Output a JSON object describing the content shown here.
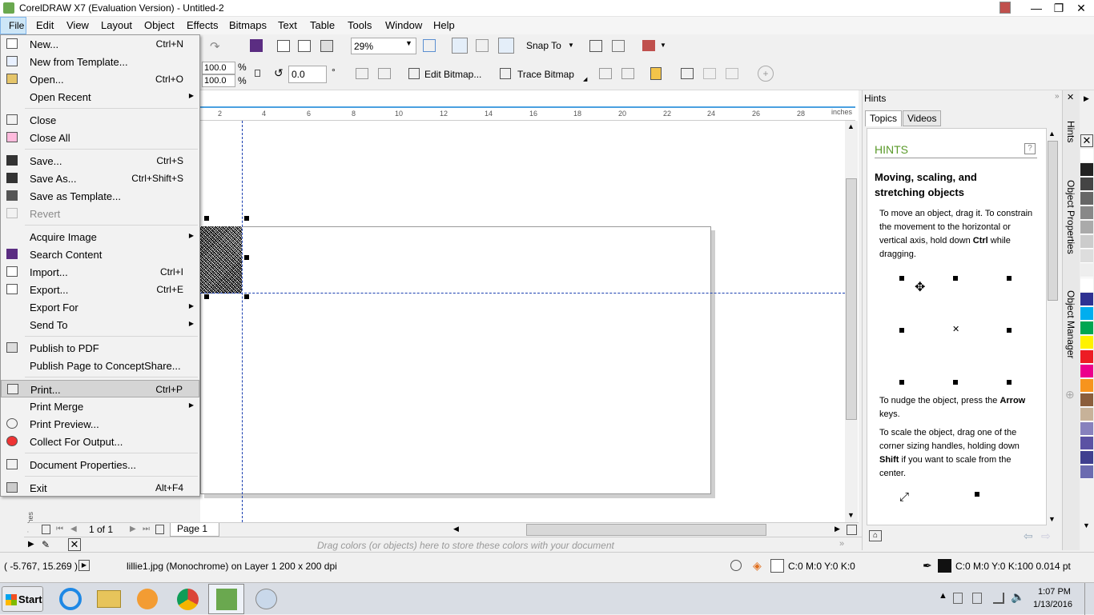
{
  "app": {
    "title": "CorelDRAW X7 (Evaluation Version) - Untitled-2"
  },
  "menubar": [
    "File",
    "Edit",
    "View",
    "Layout",
    "Object",
    "Effects",
    "Bitmaps",
    "Text",
    "Table",
    "Tools",
    "Window",
    "Help"
  ],
  "toolbar": {
    "zoom": "29%",
    "snap_to": "Snap To",
    "scale_x": "100.0",
    "scale_y": "100.0",
    "pct": "%",
    "angle": "0.0",
    "deg": "°",
    "edit_bitmap": "Edit Bitmap...",
    "trace_bitmap": "Trace Bitmap"
  },
  "ruler": {
    "unit": "inches",
    "ticks": [
      "2",
      "4",
      "6",
      "8",
      "10",
      "12",
      "14",
      "16",
      "18",
      "20",
      "22",
      "24",
      "26",
      "28"
    ]
  },
  "file_menu": [
    {
      "label": "New...",
      "shortcut": "Ctrl+N"
    },
    {
      "label": "New from Template...",
      "shortcut": ""
    },
    {
      "label": "Open...",
      "shortcut": "Ctrl+O"
    },
    {
      "label": "Open Recent",
      "shortcut": ""
    },
    {
      "label": "Close",
      "shortcut": ""
    },
    {
      "label": "Close All",
      "shortcut": ""
    },
    {
      "label": "Save...",
      "shortcut": "Ctrl+S"
    },
    {
      "label": "Save As...",
      "shortcut": "Ctrl+Shift+S"
    },
    {
      "label": "Save as Template...",
      "shortcut": ""
    },
    {
      "label": "Revert",
      "shortcut": ""
    },
    {
      "label": "Acquire Image",
      "shortcut": ""
    },
    {
      "label": "Search Content",
      "shortcut": ""
    },
    {
      "label": "Import...",
      "shortcut": "Ctrl+I"
    },
    {
      "label": "Export...",
      "shortcut": "Ctrl+E"
    },
    {
      "label": "Export For",
      "shortcut": ""
    },
    {
      "label": "Send To",
      "shortcut": ""
    },
    {
      "label": "Publish to PDF",
      "shortcut": ""
    },
    {
      "label": "Publish Page to ConceptShare...",
      "shortcut": ""
    },
    {
      "label": "Print...",
      "shortcut": "Ctrl+P"
    },
    {
      "label": "Print Merge",
      "shortcut": ""
    },
    {
      "label": "Print Preview...",
      "shortcut": ""
    },
    {
      "label": "Collect For Output...",
      "shortcut": ""
    },
    {
      "label": "Document Properties...",
      "shortcut": ""
    },
    {
      "label": "Exit",
      "shortcut": "Alt+F4"
    }
  ],
  "hints": {
    "panel_title": "Hints",
    "tab_topics": "Topics",
    "tab_videos": "Videos",
    "heading": "HINTS",
    "topic": "Moving, scaling, and stretching objects",
    "p1a": "To move an object, drag it. To constrain the movement to the horizontal or vertical axis, hold down ",
    "p1b": "Ctrl",
    "p1c": " while dragging.",
    "p2a": "To nudge the object, press the ",
    "p2b": "Arrow",
    "p2c": " keys.",
    "p3a": "To scale the object, drag one of the corner sizing handles, holding down ",
    "p3b": "Shift",
    "p3c": " if you want to scale from the center."
  },
  "docker_tabs": [
    "Hints",
    "Object Properties",
    "Object Manager"
  ],
  "pagebar": {
    "page_count": "1 of 1",
    "page_tab": "Page 1",
    "ruler_unit": "inches"
  },
  "colorbar": {
    "hint": "Drag colors (or objects) here to store these colors with your document"
  },
  "status": {
    "coords": "( -5.767, 15.269 )",
    "object_info": "lillie1.jpg (Monochrome) on Layer 1 200 x 200 dpi",
    "fill": "C:0 M:0 Y:0 K:0",
    "outline": "C:0 M:0 Y:0 K:100  0.014 pt"
  },
  "taskbar": {
    "start": "Start",
    "time": "1:07 PM",
    "date": "1/13/2016"
  },
  "palette": [
    "#ffffff",
    "#222222",
    "#444444",
    "#666666",
    "#888888",
    "#aaaaaa",
    "#cccccc",
    "#dddddd",
    "#eeeeee",
    "#ffffff",
    "#2e3192",
    "#00aeef",
    "#00a651",
    "#fff200",
    "#ed1c24",
    "#ec008c",
    "#f7941d",
    "#8b5e3c",
    "#c7b299",
    "#8781bd",
    "#5b52a3",
    "#3f3f8f",
    "#6b6bb0"
  ]
}
